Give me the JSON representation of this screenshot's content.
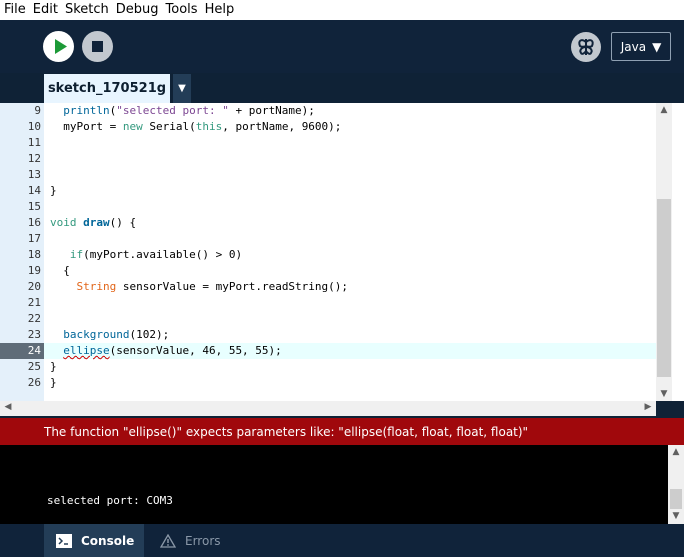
{
  "menubar": {
    "items": [
      "File",
      "Edit",
      "Sketch",
      "Debug",
      "Tools",
      "Help"
    ]
  },
  "toolbar": {
    "mode_label": "Java"
  },
  "tabs": {
    "active": "sketch_170521g"
  },
  "editor": {
    "lines": [
      {
        "num": "9",
        "text": "  println(\"selected port: \" + portName);"
      },
      {
        "num": "10",
        "text": "  myPort = new Serial(this, portName, 9600);"
      },
      {
        "num": "11",
        "text": ""
      },
      {
        "num": "12",
        "text": ""
      },
      {
        "num": "13",
        "text": ""
      },
      {
        "num": "14",
        "text": "}"
      },
      {
        "num": "15",
        "text": ""
      },
      {
        "num": "16",
        "text": "void draw() {"
      },
      {
        "num": "17",
        "text": ""
      },
      {
        "num": "18",
        "text": "   if(myPort.available() > 0)"
      },
      {
        "num": "19",
        "text": "  {"
      },
      {
        "num": "20",
        "text": "    String sensorValue = myPort.readString();"
      },
      {
        "num": "21",
        "text": ""
      },
      {
        "num": "22",
        "text": ""
      },
      {
        "num": "23",
        "text": "  background(102);"
      },
      {
        "num": "24",
        "text": "  ellipse(sensorValue, 46, 55, 55);"
      },
      {
        "num": "25",
        "text": "}"
      },
      {
        "num": "26",
        "text": "}"
      }
    ],
    "current_line": "24"
  },
  "error": {
    "message": "The function \"ellipse()\" expects parameters like: \"ellipse(float, float, float, float)\""
  },
  "console": {
    "output": "selected port: COM3"
  },
  "footer": {
    "console_label": "Console",
    "errors_label": "Errors"
  },
  "colors": {
    "error_bar": "#a0080c",
    "toolbar_bg": "#10233a",
    "run_icon": "#1c9a37"
  }
}
